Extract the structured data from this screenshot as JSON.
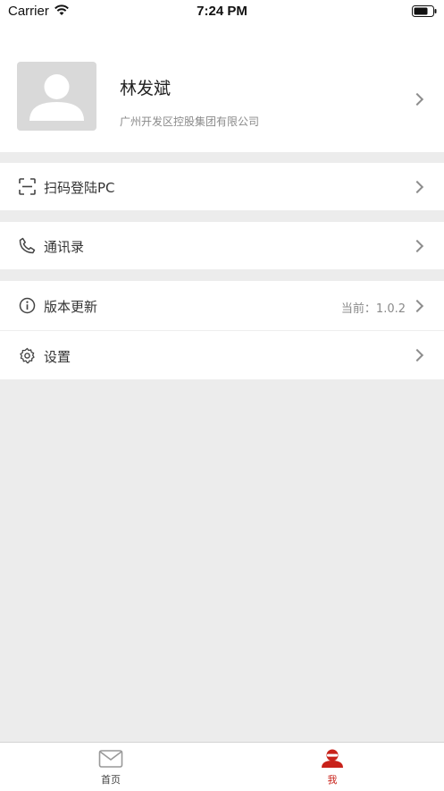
{
  "status_bar": {
    "carrier": "Carrier",
    "time": "7:24 PM"
  },
  "profile": {
    "name": "林发斌",
    "company": "广州开发区控股集团有限公司"
  },
  "menu": {
    "scan_login": {
      "label": "扫码登陆PC",
      "icon": "scan-icon"
    },
    "contacts": {
      "label": "通讯录",
      "icon": "phone-icon"
    },
    "version": {
      "label": "版本更新",
      "value": "当前：1.0.2",
      "icon": "info-icon"
    },
    "settings": {
      "label": "设置",
      "icon": "gear-icon"
    }
  },
  "tabbar": {
    "home": {
      "label": "首页",
      "icon": "mail-icon"
    },
    "me": {
      "label": "我",
      "icon": "person-icon",
      "active": true
    }
  },
  "colors": {
    "accent": "#c8221a",
    "background": "#ececec",
    "inactive_tab": "#999999"
  }
}
